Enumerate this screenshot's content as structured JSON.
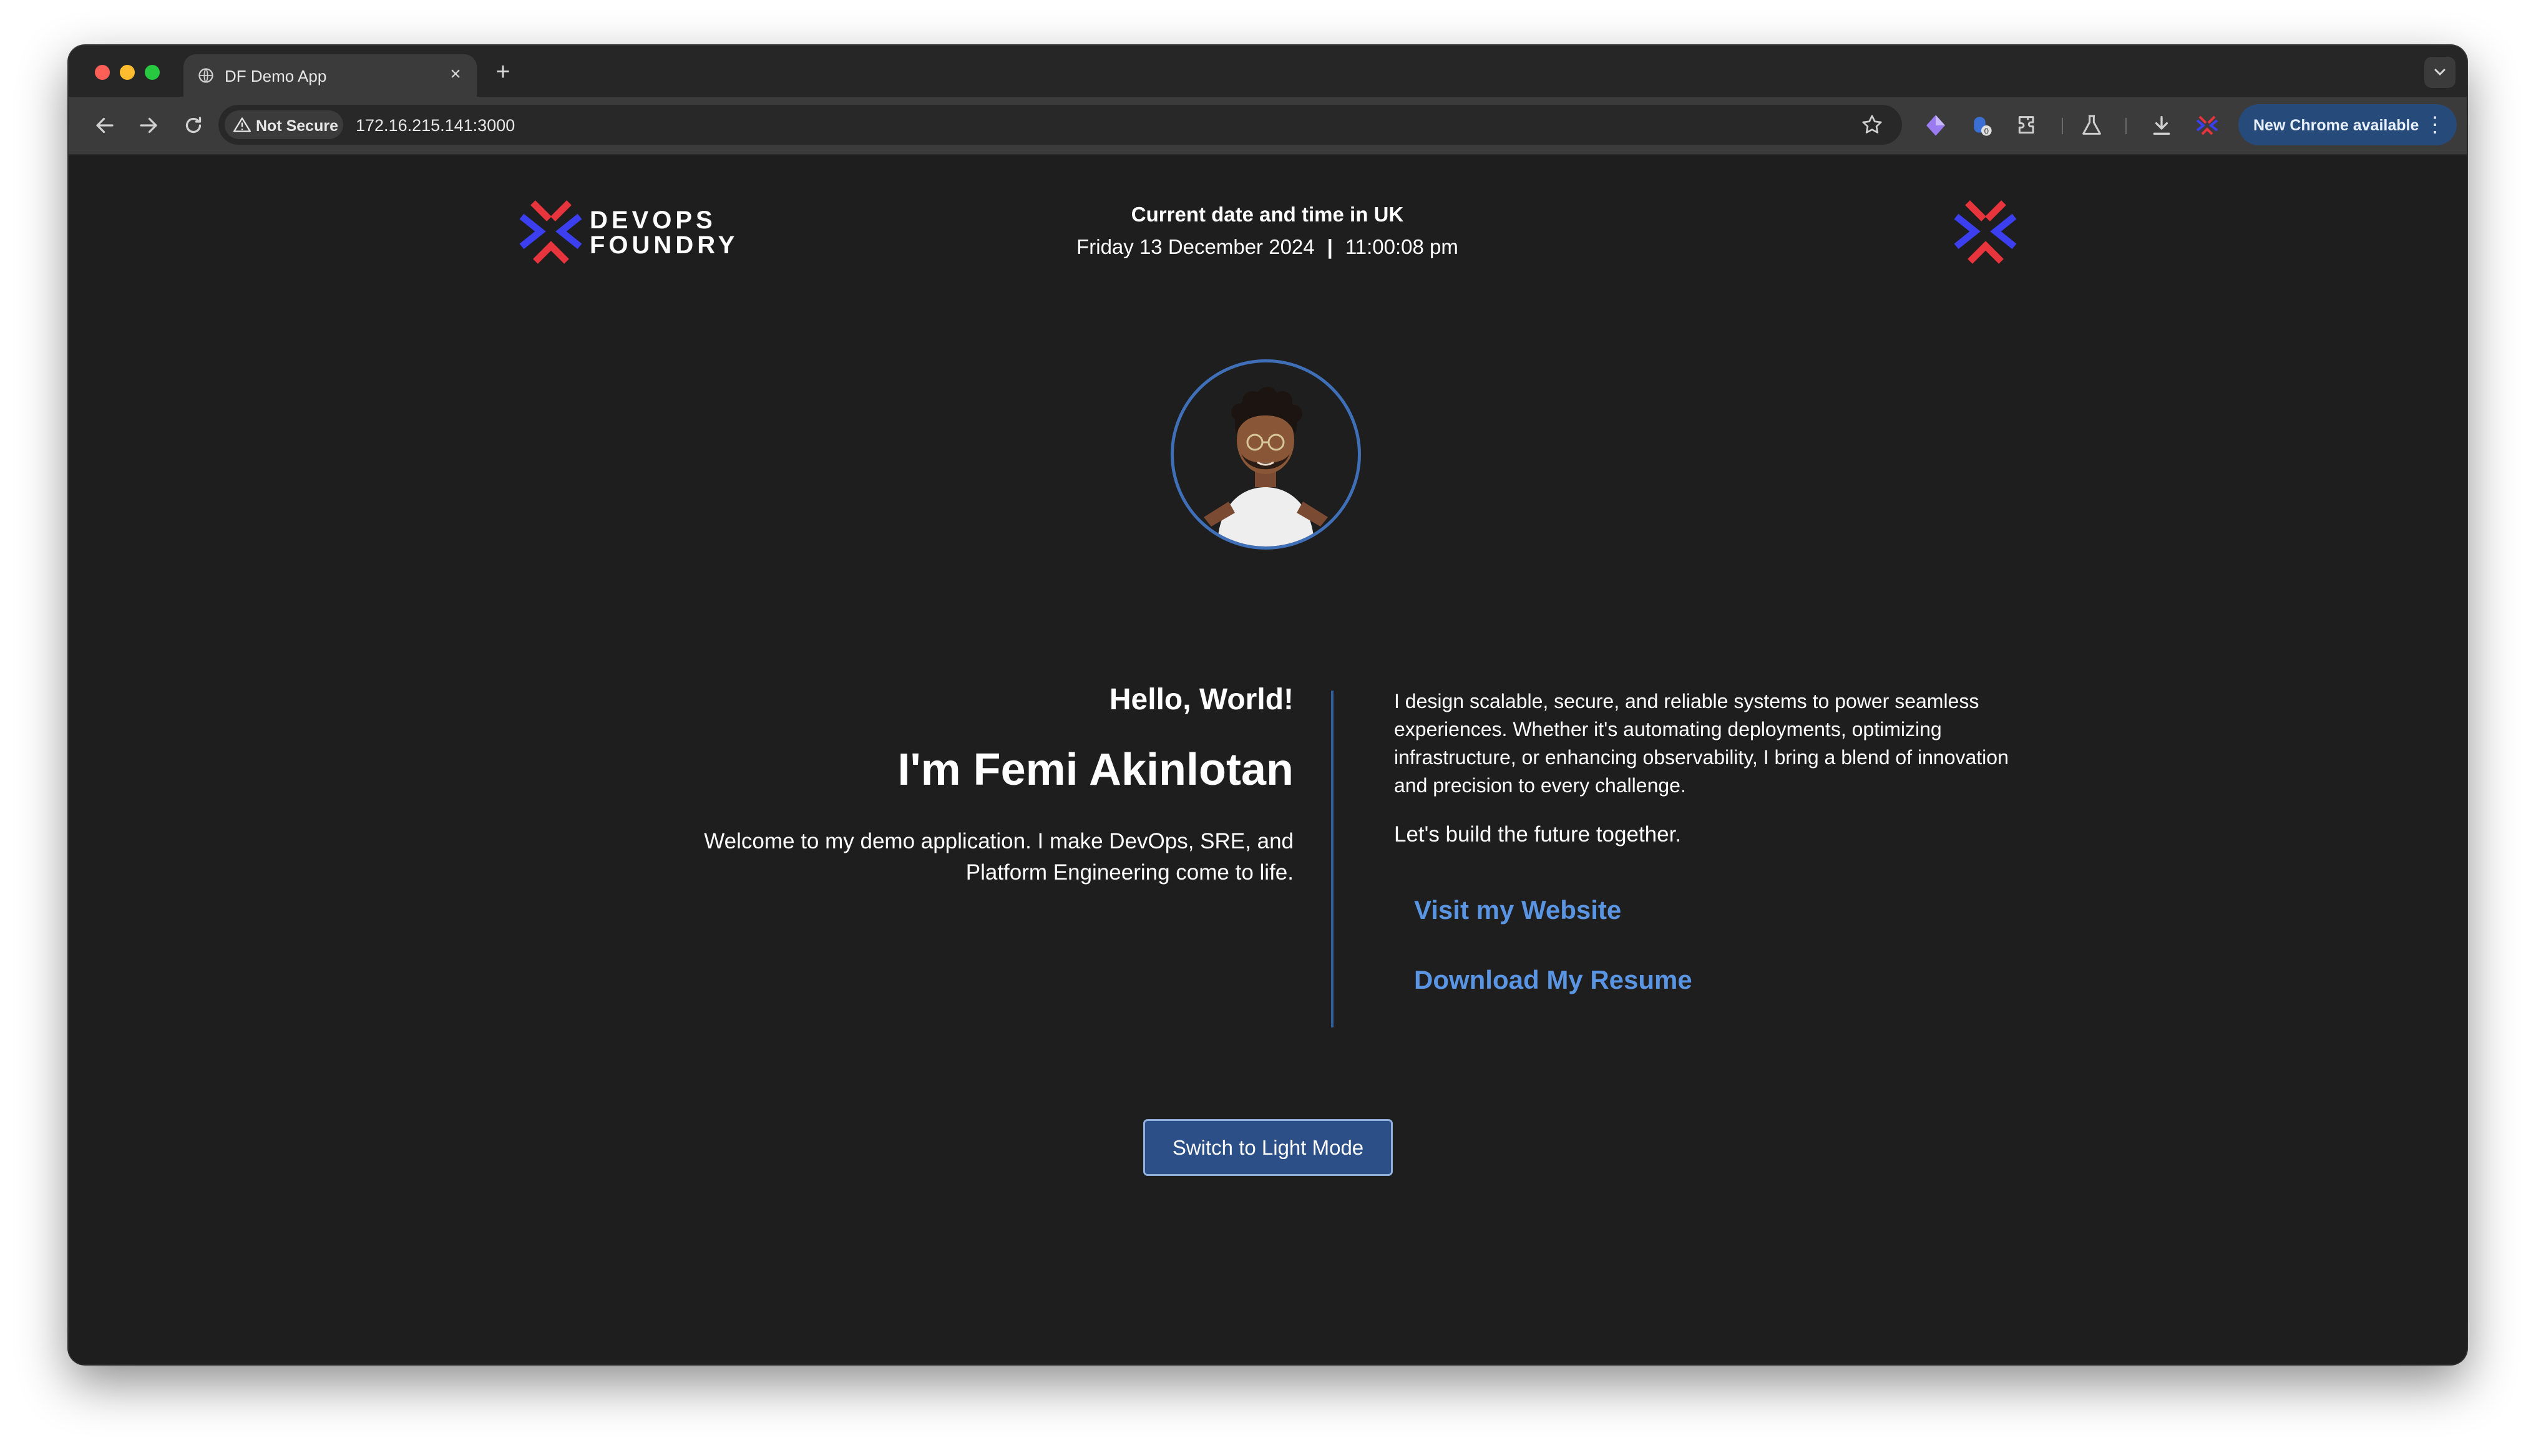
{
  "browser": {
    "tab": {
      "title": "DF Demo App",
      "favicon_icon": "globe-icon",
      "close_icon": "close-icon"
    },
    "new_tab_icon": "plus-icon",
    "tab_search_icon": "chevron-down-icon",
    "nav": {
      "back_icon": "back-arrow-icon",
      "forward_icon": "forward-arrow-icon",
      "reload_icon": "reload-icon"
    },
    "omnibox": {
      "security_label": "Not Secure",
      "security_icon": "warning-triangle-icon",
      "url": "172.16.215.141:3000",
      "bookmark_icon": "star-icon"
    },
    "extensions": [
      "gem-icon",
      "password-manager-icon",
      "puzzle-extensions-icon",
      "labs-flask-icon",
      "download-icon",
      "devops-foundry-extension-icon"
    ],
    "update_button": "New Chrome available",
    "menu_icon": "kebab-menu-icon"
  },
  "page": {
    "brand": {
      "line1": "DEVOPS",
      "line2": "FOUNDRY"
    },
    "datetime": {
      "title": "Current date and time in UK",
      "date": "Friday 13 December 2024",
      "separator": "|",
      "time": "11:00:08 pm"
    },
    "avatar_icon": "avatar-icon",
    "intro": {
      "hello": "Hello, World!",
      "name": "I'm Femi Akinlotan",
      "welcome": "Welcome to my demo application. I make DevOps, SRE, and Platform Engineering come to life."
    },
    "bio": "I design scalable, secure, and reliable systems to power seamless experiences. Whether it's automating deployments, optimizing infrastructure, or enhancing observability, I bring a blend of innovation and precision to every challenge.",
    "tagline": "Let's build the future together.",
    "links": {
      "website": "Visit my Website",
      "resume": "Download My Resume"
    },
    "theme_button": "Switch to Light Mode"
  },
  "colors": {
    "page_background": "#1e1e1e",
    "accent_blue": "#5a95e4",
    "logo_blue": "#3b3ff0",
    "logo_red": "#e8343c",
    "button_background": "#2b4f86"
  }
}
